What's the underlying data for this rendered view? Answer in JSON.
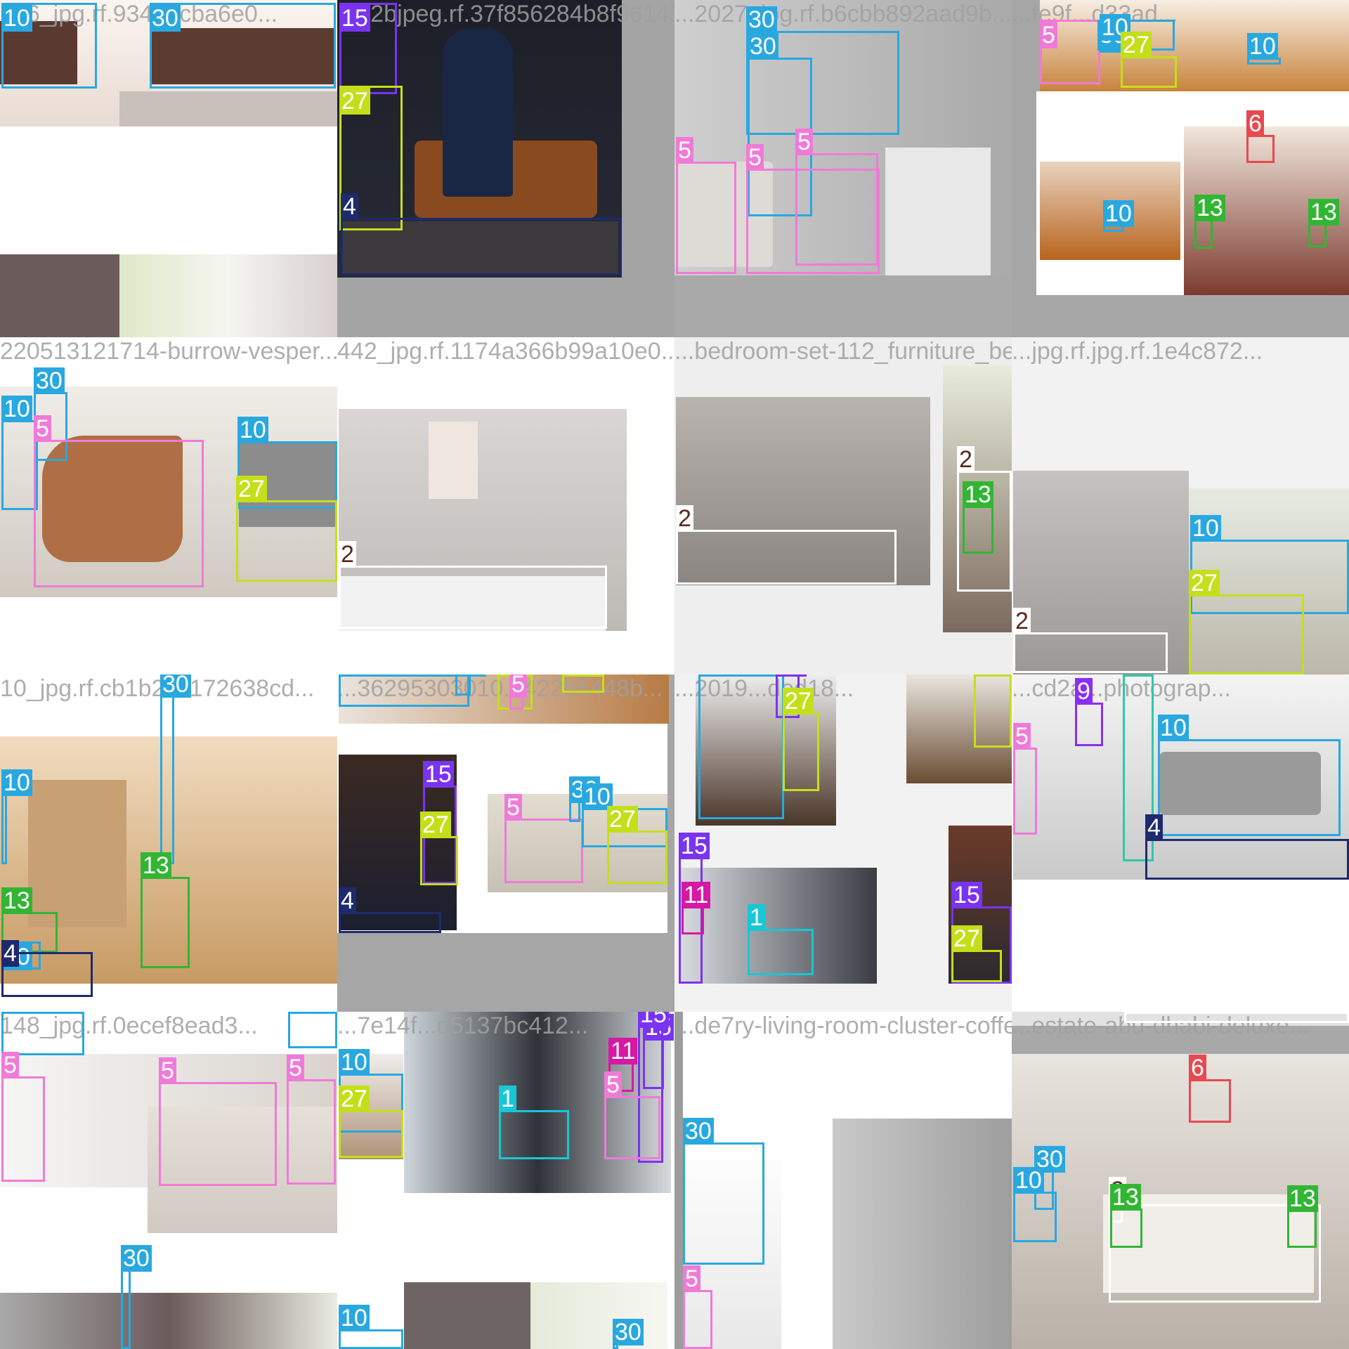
{
  "title": "Object detection training batch mosaic",
  "class_colors": {
    "1": "#17c7d6",
    "2": "#ffffff",
    "4": "#1e2a6e",
    "5": "#f07ad8",
    "6": "#e8484f",
    "9": "#8c2ef2",
    "10": "#29a8e0",
    "11": "#d618a5",
    "13": "#33b534",
    "15": "#7a33f0",
    "23": "#2cc9a8",
    "27": "#c4df1a",
    "30": "#29a8e0"
  },
  "tiles": [
    {
      "caption": "126_jpg.rf.9340ecba6e0...",
      "boxes": [
        {
          "label": "10"
        },
        {
          "label": "30"
        }
      ]
    },
    {
      "caption": "...b2bjpeg.rf.37f856284b8f96145...",
      "boxes": [
        {
          "label": "15"
        },
        {
          "label": "27"
        },
        {
          "label": "4"
        }
      ]
    },
    {
      "caption": "...2027_jpg.rf.b6cbb892aad9b...",
      "boxes": [
        {
          "label": "30"
        },
        {
          "label": "30"
        },
        {
          "label": "5"
        },
        {
          "label": "5"
        },
        {
          "label": "5"
        }
      ]
    },
    {
      "caption": "...fe9f...d33ad...",
      "boxes": [
        {
          "label": "5"
        },
        {
          "label": "30"
        },
        {
          "label": "10"
        },
        {
          "label": "27"
        },
        {
          "label": "10"
        },
        {
          "label": "6"
        },
        {
          "label": "10"
        },
        {
          "label": "13"
        },
        {
          "label": "13"
        }
      ]
    },
    {
      "caption": "220513121714-burrow-vesper...",
      "boxes": [
        {
          "label": "30"
        },
        {
          "label": "10"
        },
        {
          "label": "5"
        },
        {
          "label": "10"
        },
        {
          "label": "27"
        }
      ]
    },
    {
      "caption": "442_jpg.rf.1174a366b99a10e0...",
      "boxes": [
        {
          "label": "2"
        }
      ]
    },
    {
      "caption": "...bedroom-set-112_furniture_bed_jpg.rf.50...",
      "boxes": [
        {
          "label": "2"
        },
        {
          "label": "2"
        },
        {
          "label": "13"
        }
      ]
    },
    {
      "caption": "...jpg.rf.jpg.rf.1e4c872...",
      "boxes": [
        {
          "label": "10"
        },
        {
          "label": "27"
        },
        {
          "label": "2"
        }
      ]
    },
    {
      "caption": "10_jpg.rf.cb1b221172638cd...",
      "boxes": [
        {
          "label": "30"
        },
        {
          "label": "10"
        },
        {
          "label": "13"
        },
        {
          "label": "13"
        },
        {
          "label": "30"
        },
        {
          "label": "4"
        }
      ]
    },
    {
      "caption": "...36295303010...422b5448b...",
      "boxes": [
        {
          "label": "10"
        },
        {
          "label": "30"
        },
        {
          "label": "27"
        },
        {
          "label": "27"
        },
        {
          "label": "5"
        },
        {
          "label": "15"
        },
        {
          "label": "27"
        },
        {
          "label": "4"
        },
        {
          "label": "5"
        },
        {
          "label": "30"
        },
        {
          "label": "10"
        },
        {
          "label": "27"
        }
      ]
    },
    {
      "caption": "...2019...ded18...",
      "boxes": [
        {
          "label": "10"
        },
        {
          "label": "15"
        },
        {
          "label": "27"
        },
        {
          "label": "27"
        },
        {
          "label": "15"
        },
        {
          "label": "11"
        },
        {
          "label": "1"
        },
        {
          "label": "15"
        },
        {
          "label": "27"
        }
      ]
    },
    {
      "caption": "...cd2a...photograp...",
      "boxes": [
        {
          "label": "9"
        },
        {
          "label": "23"
        },
        {
          "label": "5"
        },
        {
          "label": "10"
        },
        {
          "label": "4"
        }
      ]
    },
    {
      "caption": "148_jpg.rf.0ecef8ead3...",
      "boxes": [
        {
          "label": "30"
        },
        {
          "label": "30"
        },
        {
          "label": "5"
        },
        {
          "label": "5"
        },
        {
          "label": "5"
        },
        {
          "label": "30"
        }
      ]
    },
    {
      "caption": "...7e14f...d5137bc412...",
      "boxes": [
        {
          "label": "10"
        },
        {
          "label": "27"
        },
        {
          "label": "15"
        },
        {
          "label": "15"
        },
        {
          "label": "11"
        },
        {
          "label": "1"
        },
        {
          "label": "5"
        },
        {
          "label": "10"
        },
        {
          "label": "30"
        }
      ]
    },
    {
      "caption": "...de7ry-living-room-cluster-coffee...",
      "boxes": [
        {
          "label": "30"
        },
        {
          "label": "5"
        }
      ]
    },
    {
      "caption": "...estate-abu-dhabi-deluxe...",
      "boxes": [
        {
          "label": "2"
        },
        {
          "label": "6"
        },
        {
          "label": "30"
        },
        {
          "label": "10"
        },
        {
          "label": "2"
        },
        {
          "label": "13"
        },
        {
          "label": "13"
        }
      ]
    }
  ]
}
